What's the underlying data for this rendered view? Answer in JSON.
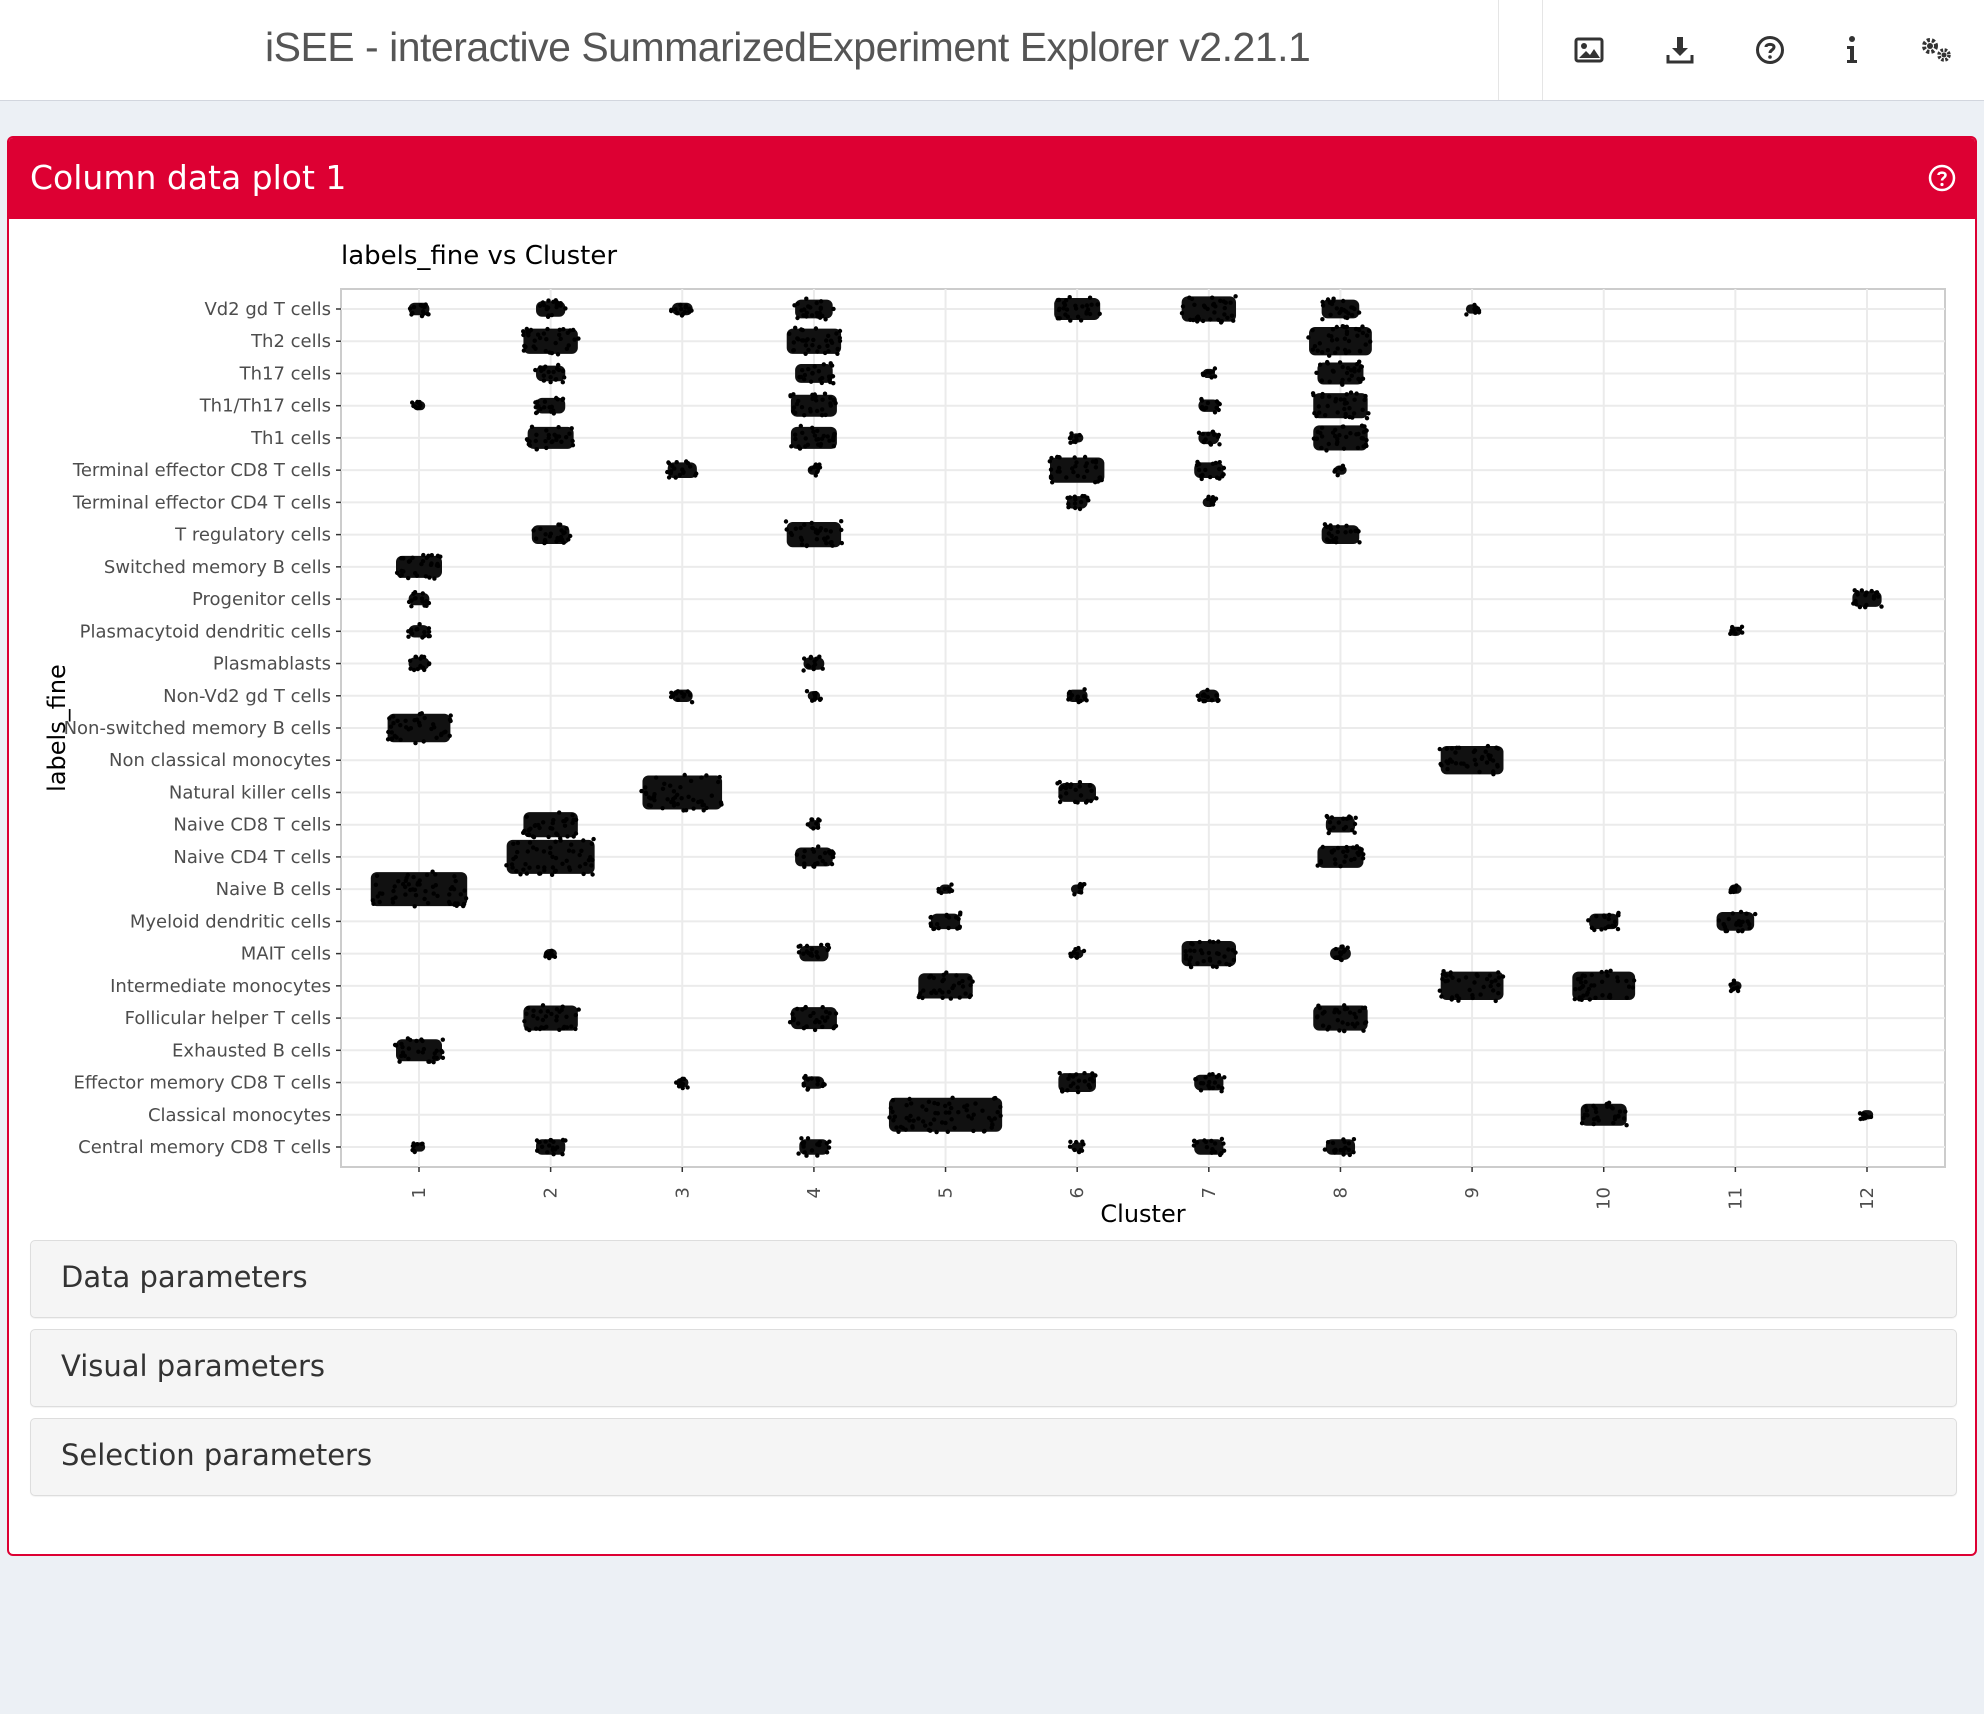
{
  "header": {
    "title": "iSEE - interactive SummarizedExperiment Explorer v2.21.1",
    "icons": [
      "image-icon",
      "download-icon",
      "question-circle-icon",
      "info-icon",
      "gears-icon"
    ]
  },
  "panel": {
    "title": "Column data plot 1",
    "accent": "#dd0033"
  },
  "sections": {
    "data": "Data parameters",
    "visual": "Visual parameters",
    "selection": "Selection parameters"
  },
  "chart_data": {
    "type": "scatter",
    "title": "labels_fine vs Cluster",
    "xlabel": "Cluster",
    "ylabel": "labels_fine",
    "grid": true,
    "categories": [
      "1",
      "2",
      "3",
      "4",
      "5",
      "6",
      "7",
      "8",
      "9",
      "10",
      "11",
      "12"
    ],
    "labels": [
      "Vd2 gd T cells",
      "Th2 cells",
      "Th17 cells",
      "Th1/Th17 cells",
      "Th1 cells",
      "Terminal effector CD8 T cells",
      "Terminal effector CD4 T cells",
      "T regulatory cells",
      "Switched memory B cells",
      "Progenitor cells",
      "Plasmacytoid dendritic cells",
      "Plasmablasts",
      "Non-Vd2 gd T cells",
      "Non-switched memory B cells",
      "Non classical monocytes",
      "Natural killer cells",
      "Naive CD8 T cells",
      "Naive CD4 T cells",
      "Naive B cells",
      "Myeloid dendritic cells",
      "MAIT cells",
      "Intermediate monocytes",
      "Follicular helper T cells",
      "Exhausted B cells",
      "Effector memory CD8 T cells",
      "Classical monocytes",
      "Central memory CD8 T cells"
    ],
    "clusters": [
      {
        "label": "Vd2 gd T cells",
        "cluster": "1",
        "size": 2
      },
      {
        "label": "Vd2 gd T cells",
        "cluster": "2",
        "size": 3
      },
      {
        "label": "Vd2 gd T cells",
        "cluster": "3",
        "size": 2
      },
      {
        "label": "Vd2 gd T cells",
        "cluster": "4",
        "size": 4
      },
      {
        "label": "Vd2 gd T cells",
        "cluster": "6",
        "size": 5
      },
      {
        "label": "Vd2 gd T cells",
        "cluster": "7",
        "size": 6
      },
      {
        "label": "Vd2 gd T cells",
        "cluster": "8",
        "size": 4
      },
      {
        "label": "Vd2 gd T cells",
        "cluster": "9",
        "size": 1
      },
      {
        "label": "Th2 cells",
        "cluster": "2",
        "size": 6
      },
      {
        "label": "Th2 cells",
        "cluster": "4",
        "size": 6
      },
      {
        "label": "Th2 cells",
        "cluster": "8",
        "size": 7
      },
      {
        "label": "Th17 cells",
        "cluster": "2",
        "size": 3
      },
      {
        "label": "Th17 cells",
        "cluster": "4",
        "size": 4
      },
      {
        "label": "Th17 cells",
        "cluster": "7",
        "size": 1
      },
      {
        "label": "Th17 cells",
        "cluster": "8",
        "size": 5
      },
      {
        "label": "Th1/Th17 cells",
        "cluster": "1",
        "size": 1
      },
      {
        "label": "Th1/Th17 cells",
        "cluster": "2",
        "size": 3
      },
      {
        "label": "Th1/Th17 cells",
        "cluster": "4",
        "size": 5
      },
      {
        "label": "Th1/Th17 cells",
        "cluster": "7",
        "size": 2
      },
      {
        "label": "Th1/Th17 cells",
        "cluster": "8",
        "size": 6
      },
      {
        "label": "Th1 cells",
        "cluster": "2",
        "size": 5
      },
      {
        "label": "Th1 cells",
        "cluster": "4",
        "size": 5
      },
      {
        "label": "Th1 cells",
        "cluster": "6",
        "size": 1
      },
      {
        "label": "Th1 cells",
        "cluster": "7",
        "size": 2
      },
      {
        "label": "Th1 cells",
        "cluster": "8",
        "size": 6
      },
      {
        "label": "Terminal effector CD8 T cells",
        "cluster": "3",
        "size": 3
      },
      {
        "label": "Terminal effector CD8 T cells",
        "cluster": "4",
        "size": 1
      },
      {
        "label": "Terminal effector CD8 T cells",
        "cluster": "6",
        "size": 6
      },
      {
        "label": "Terminal effector CD8 T cells",
        "cluster": "7",
        "size": 3
      },
      {
        "label": "Terminal effector CD8 T cells",
        "cluster": "8",
        "size": 1
      },
      {
        "label": "Terminal effector CD4 T cells",
        "cluster": "6",
        "size": 2
      },
      {
        "label": "Terminal effector CD4 T cells",
        "cluster": "7",
        "size": 1
      },
      {
        "label": "T regulatory cells",
        "cluster": "2",
        "size": 4
      },
      {
        "label": "T regulatory cells",
        "cluster": "4",
        "size": 6
      },
      {
        "label": "T regulatory cells",
        "cluster": "8",
        "size": 4
      },
      {
        "label": "Switched memory B cells",
        "cluster": "1",
        "size": 5
      },
      {
        "label": "Progenitor cells",
        "cluster": "1",
        "size": 2
      },
      {
        "label": "Progenitor cells",
        "cluster": "12",
        "size": 3
      },
      {
        "label": "Plasmacytoid dendritic cells",
        "cluster": "1",
        "size": 2
      },
      {
        "label": "Plasmacytoid dendritic cells",
        "cluster": "11",
        "size": 1
      },
      {
        "label": "Plasmablasts",
        "cluster": "1",
        "size": 2
      },
      {
        "label": "Plasmablasts",
        "cluster": "4",
        "size": 2
      },
      {
        "label": "Non-Vd2 gd T cells",
        "cluster": "3",
        "size": 2
      },
      {
        "label": "Non-Vd2 gd T cells",
        "cluster": "4",
        "size": 1
      },
      {
        "label": "Non-Vd2 gd T cells",
        "cluster": "6",
        "size": 2
      },
      {
        "label": "Non-Vd2 gd T cells",
        "cluster": "7",
        "size": 2
      },
      {
        "label": "Non-switched memory B cells",
        "cluster": "1",
        "size": 7
      },
      {
        "label": "Non classical monocytes",
        "cluster": "9",
        "size": 7
      },
      {
        "label": "Natural killer cells",
        "cluster": "3",
        "size": 9
      },
      {
        "label": "Natural killer cells",
        "cluster": "6",
        "size": 4
      },
      {
        "label": "Naive CD8 T cells",
        "cluster": "2",
        "size": 6
      },
      {
        "label": "Naive CD8 T cells",
        "cluster": "4",
        "size": 1
      },
      {
        "label": "Naive CD8 T cells",
        "cluster": "8",
        "size": 3
      },
      {
        "label": "Naive CD4 T cells",
        "cluster": "2",
        "size": 10
      },
      {
        "label": "Naive CD4 T cells",
        "cluster": "4",
        "size": 4
      },
      {
        "label": "Naive CD4 T cells",
        "cluster": "8",
        "size": 5
      },
      {
        "label": "Naive B cells",
        "cluster": "1",
        "size": 11
      },
      {
        "label": "Naive B cells",
        "cluster": "5",
        "size": 1
      },
      {
        "label": "Naive B cells",
        "cluster": "6",
        "size": 1
      },
      {
        "label": "Naive B cells",
        "cluster": "11",
        "size": 1
      },
      {
        "label": "Myeloid dendritic cells",
        "cluster": "5",
        "size": 3
      },
      {
        "label": "Myeloid dendritic cells",
        "cluster": "10",
        "size": 3
      },
      {
        "label": "Myeloid dendritic cells",
        "cluster": "11",
        "size": 4
      },
      {
        "label": "MAIT cells",
        "cluster": "2",
        "size": 1
      },
      {
        "label": "MAIT cells",
        "cluster": "4",
        "size": 3
      },
      {
        "label": "MAIT cells",
        "cluster": "6",
        "size": 1
      },
      {
        "label": "MAIT cells",
        "cluster": "7",
        "size": 6
      },
      {
        "label": "MAIT cells",
        "cluster": "8",
        "size": 2
      },
      {
        "label": "Intermediate monocytes",
        "cluster": "5",
        "size": 6
      },
      {
        "label": "Intermediate monocytes",
        "cluster": "9",
        "size": 7
      },
      {
        "label": "Intermediate monocytes",
        "cluster": "10",
        "size": 7
      },
      {
        "label": "Intermediate monocytes",
        "cluster": "11",
        "size": 1
      },
      {
        "label": "Follicular helper T cells",
        "cluster": "2",
        "size": 6
      },
      {
        "label": "Follicular helper T cells",
        "cluster": "4",
        "size": 5
      },
      {
        "label": "Follicular helper T cells",
        "cluster": "8",
        "size": 6
      },
      {
        "label": "Exhausted B cells",
        "cluster": "1",
        "size": 5
      },
      {
        "label": "Effector memory CD8 T cells",
        "cluster": "3",
        "size": 1
      },
      {
        "label": "Effector memory CD8 T cells",
        "cluster": "4",
        "size": 2
      },
      {
        "label": "Effector memory CD8 T cells",
        "cluster": "6",
        "size": 4
      },
      {
        "label": "Effector memory CD8 T cells",
        "cluster": "7",
        "size": 3
      },
      {
        "label": "Classical monocytes",
        "cluster": "5",
        "size": 13
      },
      {
        "label": "Classical monocytes",
        "cluster": "10",
        "size": 5
      },
      {
        "label": "Classical monocytes",
        "cluster": "12",
        "size": 1
      },
      {
        "label": "Central memory CD8 T cells",
        "cluster": "1",
        "size": 1
      },
      {
        "label": "Central memory CD8 T cells",
        "cluster": "2",
        "size": 3
      },
      {
        "label": "Central memory CD8 T cells",
        "cluster": "4",
        "size": 3
      },
      {
        "label": "Central memory CD8 T cells",
        "cluster": "6",
        "size": 1
      },
      {
        "label": "Central memory CD8 T cells",
        "cluster": "7",
        "size": 3
      },
      {
        "label": "Central memory CD8 T cells",
        "cluster": "8",
        "size": 3
      }
    ]
  }
}
